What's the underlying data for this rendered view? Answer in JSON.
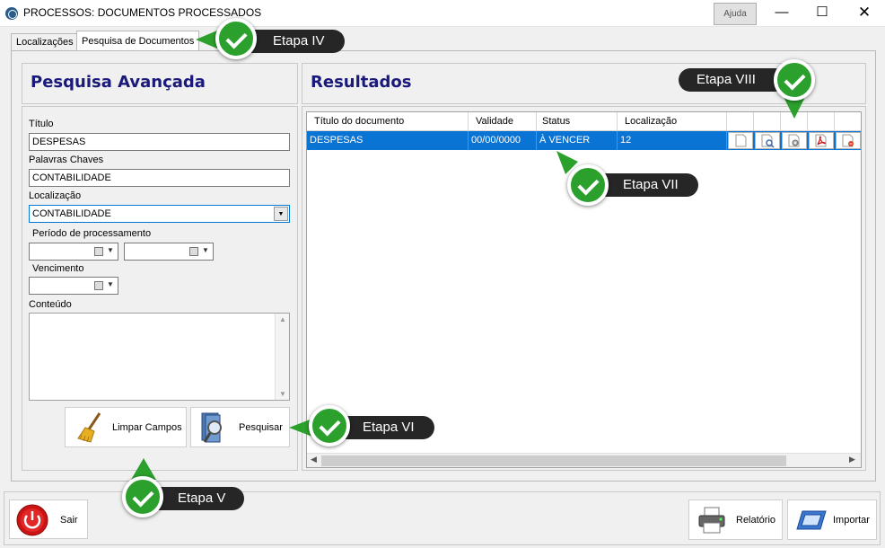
{
  "window": {
    "title": "PROCESSOS: DOCUMENTOS PROCESSADOS",
    "help_label": "Ajuda",
    "minimize": "—",
    "maximize": "☐",
    "close": "✕"
  },
  "tabs": [
    {
      "label": "Localizações"
    },
    {
      "label": "Pesquisa de Documentos"
    }
  ],
  "search_panel": {
    "heading": "Pesquisa Avançada",
    "titulo_label": "Título",
    "titulo_value": "DESPESAS",
    "palavras_label": "Palavras Chaves",
    "palavras_value": "CONTABILIDADE",
    "localizacao_label": "Localização",
    "localizacao_value": "CONTABILIDADE",
    "periodo_label": "Período de processamento",
    "vencimento_label": "Vencimento",
    "conteudo_label": "Conteúdo",
    "clear_button": "Limpar Campos",
    "search_button": "Pesquisar"
  },
  "results_panel": {
    "heading": "Resultados",
    "columns": [
      "Título do documento",
      "Validade",
      "Status",
      "Localização"
    ],
    "rows": [
      {
        "titulo": "DESPESAS",
        "validade": "00/00/0000",
        "status": "À VENCER",
        "localizacao": "12"
      }
    ]
  },
  "bottom_bar": {
    "exit_button": "Sair",
    "report_button": "Relatório",
    "import_button": "Importar"
  },
  "callouts": {
    "step4": "Etapa IV",
    "step5": "Etapa V",
    "step6": "Etapa VI",
    "step7": "Etapa VII",
    "step8": "Etapa VIII"
  },
  "colors": {
    "heading": "#1a1a7a",
    "selected_row": "#0a74d4",
    "check_green": "#2ca02c",
    "callout_bg": "#262626"
  }
}
